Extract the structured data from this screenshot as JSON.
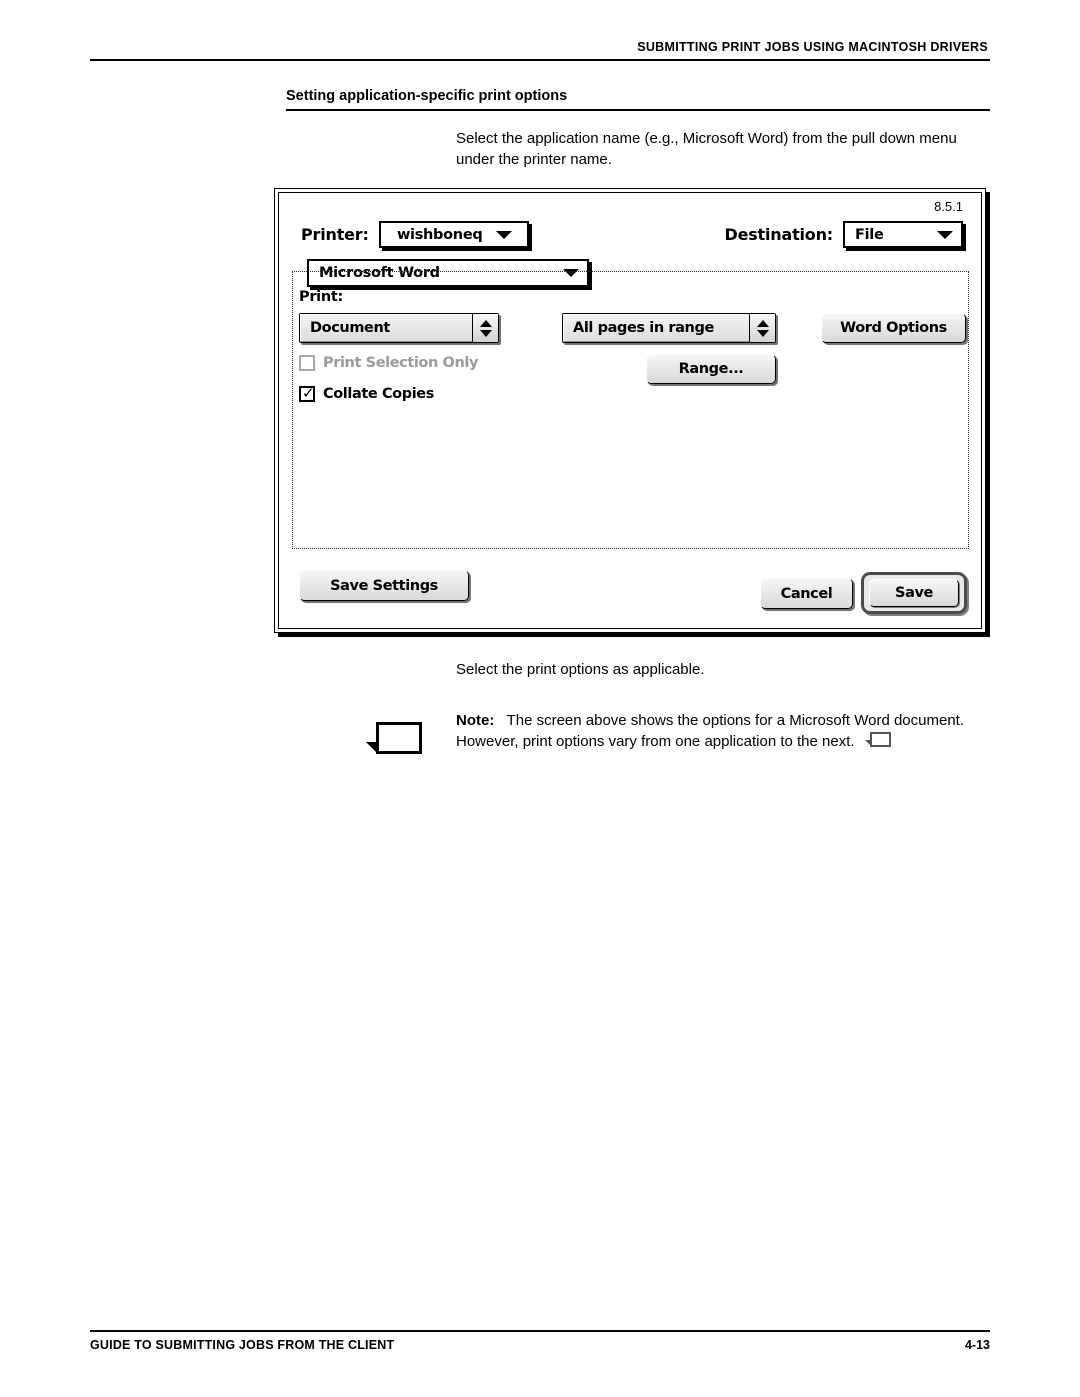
{
  "header": {
    "running_title": "SUBMITTING PRINT JOBS USING MACINTOSH DRIVERS"
  },
  "section": {
    "heading": "Setting application-specific print options"
  },
  "body": {
    "intro_paragraph": "Select the application name (e.g., Microsoft Word) from the pull down menu under the printer name.",
    "after_paragraph": "Select the print options as applicable."
  },
  "note": {
    "label": "Note:",
    "text": "The screen above shows the options for a Microsoft Word document. However, print options vary from one application to the next.",
    "icon": "note-flag-icon",
    "end_marker": "note-end-marker-icon"
  },
  "dialog": {
    "version": "8.5.1",
    "printer_label": "Printer:",
    "printer_value": "wishboneq",
    "destination_label": "Destination:",
    "destination_value": "File",
    "application_value": "Microsoft Word",
    "print_label": "Print:",
    "print_scope_value": "Document",
    "pages_value": "All pages in range",
    "word_options_label": "Word Options",
    "range_label": "Range...",
    "print_selection_label": "Print Selection Only",
    "print_selection_checked": false,
    "print_selection_enabled": false,
    "collate_label": "Collate Copies",
    "collate_checked": true,
    "collate_tick": "✓",
    "save_settings_label": "Save Settings",
    "cancel_label": "Cancel",
    "save_label": "Save"
  },
  "footer": {
    "text": "GUIDE TO SUBMITTING JOBS FROM THE CLIENT",
    "page": "4-13"
  }
}
